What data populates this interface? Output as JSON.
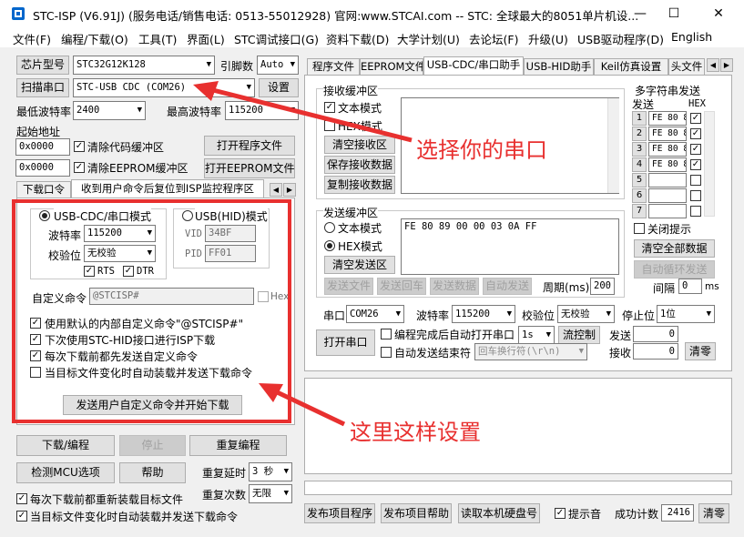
{
  "window": {
    "title": "STC-ISP (V6.91J) (服务电话/销售电话: 0513-55012928) 官网:www.STCAI.com  -- STC: 全球最大的8051单片机设...",
    "minimize": "—",
    "maximize": "☐",
    "close": "✕"
  },
  "menu": [
    "文件(F)",
    "编程/下载(O)",
    "工具(T)",
    "界面(L)",
    "STC调试接口(G)",
    "资料下载(D)",
    "大学计划(U)",
    "去论坛(F)",
    "升级(U)",
    "USB驱动程序(D)",
    "English"
  ],
  "left": {
    "chip_label": "芯片型号",
    "chip_value": "STC32G12K128",
    "pins_label": "引脚数",
    "pins_value": "Auto",
    "scan_label": "扫描串口",
    "port_value": "STC-USB CDC (COM26)",
    "settings_label": "设置",
    "min_baud_label": "最低波特率",
    "min_baud_value": "2400",
    "max_baud_label": "最高波特率",
    "max_baud_value": "115200",
    "start_addr_label": "起始地址",
    "addr1": "0x0000",
    "clear_code": "清除代码缓冲区",
    "open_program": "打开程序文件",
    "addr2": "0x0000",
    "clear_eeprom": "清除EEPROM缓冲区",
    "open_eeprom": "打开EEPROM文件",
    "tab_download": "下载口令",
    "tab_isp": "收到用户命令后复位到ISP监控程序区",
    "usb_cdc_mode": "USB-CDC/串口模式",
    "usb_hid_mode": "USB(HID)模式",
    "baud_label": "波特率",
    "baud_value": "115200",
    "parity_label": "校验位",
    "parity_value": "无校验",
    "rts": "RTS",
    "dtr": "DTR",
    "vid_label": "VID",
    "vid_value": "34BF",
    "pid_label": "PID",
    "pid_value": "FF01",
    "custom_cmd_label": "自定义命令",
    "custom_cmd_value": "@STCISP#",
    "hex_label": "Hex",
    "opt1": "使用默认的内部自定义命令\"@STCISP#\"",
    "opt2": "下次使用STC-HID接口进行ISP下载",
    "opt3": "每次下载前都先发送自定义命令",
    "opt4": "当目标文件变化时自动装载并发送下载命令",
    "send_btn": "发送用户自定义命令并开始下载",
    "download_btn": "下载/编程",
    "stop_btn": "停止",
    "reprogram_btn": "重复编程",
    "detect_btn": "检测MCU选项",
    "help_btn": "帮助",
    "delay_label": "重复延时",
    "delay_value": "3 秒",
    "count_label": "重复次数",
    "count_value": "无限",
    "reload_each": "每次下载前都重新装载目标文件",
    "auto_reload": "当目标文件变化时自动装载并发送下载命令"
  },
  "right": {
    "tabs": [
      "程序文件",
      "EEPROM文件",
      "USB-CDC/串口助手",
      "USB-HID助手",
      "Keil仿真设置",
      "头文件"
    ],
    "recv_group": "接收缓冲区",
    "recv_text": "文本模式",
    "recv_hex": "HEX模式",
    "clear_recv": "清空接收区",
    "save_recv": "保存接收数据",
    "copy_recv": "复制接收数据",
    "send_group": "发送缓冲区",
    "send_text": "文本模式",
    "send_hex": "HEX模式",
    "clear_send": "清空发送区",
    "send_data": "FE 80 89 00 00 03 0A FF",
    "send_file": "发送文件",
    "send_return": "发送回车",
    "send_btn": "发送数据",
    "auto_send": "自动发送",
    "period_label": "周期(ms)",
    "period_value": "200",
    "multi_title": "多字符串发送",
    "multi_send": "发送",
    "multi_hex": "HEX",
    "multi_rows": [
      {
        "n": "1",
        "v": "FE 80 8",
        "hex": "✓"
      },
      {
        "n": "2",
        "v": "FE 80 8",
        "hex": "✓"
      },
      {
        "n": "3",
        "v": "FE 80 8",
        "hex": "✓"
      },
      {
        "n": "4",
        "v": "FE 80 8",
        "hex": "✓"
      },
      {
        "n": "5",
        "v": "",
        "hex": ""
      },
      {
        "n": "6",
        "v": "",
        "hex": ""
      },
      {
        "n": "7",
        "v": "",
        "hex": ""
      }
    ],
    "close_tip": "关闭提示",
    "clear_all": "清空全部数据",
    "auto_loop": "自动循环发送",
    "interval_label": "间隔",
    "interval_value": "0",
    "interval_unit": "ms",
    "port_label": "串口",
    "port_value": "COM26",
    "baud_label": "波特率",
    "baud_value": "115200",
    "parity_label": "校验位",
    "parity_value": "无校验",
    "stop_label": "停止位",
    "stop_value": "1位",
    "open_port": "打开串口",
    "auto_open": "编程完成后自动打开串口",
    "auto_open_sec": "1s",
    "flow_ctrl": "流控制",
    "send_label": "发送",
    "send_count": "0",
    "auto_end": "自动发送结束符",
    "end_char": "回车换行符(\\r\\n)",
    "recv_label": "接收",
    "recv_count": "0",
    "clear_count": "清零",
    "publish_prog": "发布项目程序",
    "publish_help": "发布项目帮助",
    "read_disk": "读取本机硬盘号",
    "tip_sound": "提示音",
    "success_label": "成功计数",
    "success_value": "2416",
    "clear_success": "清零"
  },
  "annotations": {
    "select_port": "选择你的串口",
    "set_here": "这里这样设置"
  },
  "colors": {
    "annotation_red": "#e8302f",
    "title_blue": "#0066cc"
  }
}
